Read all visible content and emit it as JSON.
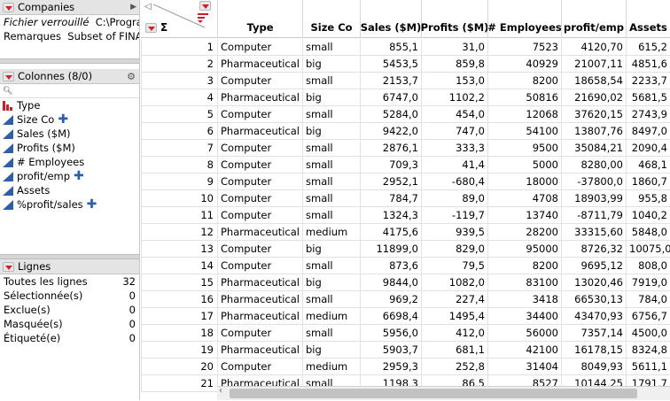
{
  "companies": {
    "title": "Companies",
    "locked_label": "Fichier verrouillé",
    "locked_value": "C:\\Progra",
    "notes_label": "Remarques",
    "notes_value": "Subset of FINA"
  },
  "columns": {
    "title": "Colonnes (8/0)",
    "items": [
      {
        "label": "Type",
        "icon": "nominal-bar-icon",
        "plus": false
      },
      {
        "label": "Size Co",
        "icon": "continuous-triangle-icon",
        "plus": true
      },
      {
        "label": "Sales ($M)",
        "icon": "continuous-triangle-icon",
        "plus": false
      },
      {
        "label": "Profits ($M)",
        "icon": "continuous-triangle-icon",
        "plus": false
      },
      {
        "label": "# Employees",
        "icon": "continuous-triangle-icon",
        "plus": false
      },
      {
        "label": "profit/emp",
        "icon": "continuous-triangle-icon",
        "plus": true
      },
      {
        "label": "Assets",
        "icon": "continuous-triangle-icon",
        "plus": false
      },
      {
        "label": "%profit/sales",
        "icon": "continuous-triangle-icon",
        "plus": true
      }
    ]
  },
  "rows_panel": {
    "title": "Lignes",
    "items": [
      {
        "label": "Toutes les lignes",
        "value": "32"
      },
      {
        "label": "Sélectionnée(s)",
        "value": "0"
      },
      {
        "label": "Exclue(s)",
        "value": "0"
      },
      {
        "label": "Masquée(s)",
        "value": "0"
      },
      {
        "label": "Étiqueté(e)",
        "value": "0"
      }
    ]
  },
  "table": {
    "headers": [
      "Type",
      "Size Co",
      "Sales ($M)",
      "Profits ($M)",
      "# Employees",
      "profit/emp",
      "Assets"
    ],
    "rows": [
      [
        "1",
        "Computer",
        "small",
        "855,1",
        "31,0",
        "7523",
        "4120,70",
        "615,2"
      ],
      [
        "2",
        "Pharmaceutical",
        "big",
        "5453,5",
        "859,8",
        "40929",
        "21007,11",
        "4851,6"
      ],
      [
        "3",
        "Computer",
        "small",
        "2153,7",
        "153,0",
        "8200",
        "18658,54",
        "2233,7"
      ],
      [
        "4",
        "Pharmaceutical",
        "big",
        "6747,0",
        "1102,2",
        "50816",
        "21690,02",
        "5681,5"
      ],
      [
        "5",
        "Computer",
        "small",
        "5284,0",
        "454,0",
        "12068",
        "37620,15",
        "2743,9"
      ],
      [
        "6",
        "Pharmaceutical",
        "big",
        "9422,0",
        "747,0",
        "54100",
        "13807,76",
        "8497,0"
      ],
      [
        "7",
        "Computer",
        "small",
        "2876,1",
        "333,3",
        "9500",
        "35084,21",
        "2090,4"
      ],
      [
        "8",
        "Computer",
        "small",
        "709,3",
        "41,4",
        "5000",
        "8280,00",
        "468,1"
      ],
      [
        "9",
        "Computer",
        "small",
        "2952,1",
        "-680,4",
        "18000",
        "-37800,0",
        "1860,7"
      ],
      [
        "10",
        "Computer",
        "small",
        "784,7",
        "89,0",
        "4708",
        "18903,99",
        "955,8"
      ],
      [
        "11",
        "Computer",
        "small",
        "1324,3",
        "-119,7",
        "13740",
        "-8711,79",
        "1040,2"
      ],
      [
        "12",
        "Pharmaceutical",
        "medium",
        "4175,6",
        "939,5",
        "28200",
        "33315,60",
        "5848,0"
      ],
      [
        "13",
        "Computer",
        "big",
        "11899,0",
        "829,0",
        "95000",
        "8726,32",
        "10075,0"
      ],
      [
        "14",
        "Computer",
        "small",
        "873,6",
        "79,5",
        "8200",
        "9695,12",
        "808,0"
      ],
      [
        "15",
        "Pharmaceutical",
        "big",
        "9844,0",
        "1082,0",
        "83100",
        "13020,46",
        "7919,0"
      ],
      [
        "16",
        "Pharmaceutical",
        "small",
        "969,2",
        "227,4",
        "3418",
        "66530,13",
        "784,0"
      ],
      [
        "17",
        "Pharmaceutical",
        "medium",
        "6698,4",
        "1495,4",
        "34400",
        "43470,93",
        "6756,7"
      ],
      [
        "18",
        "Computer",
        "small",
        "5956,0",
        "412,0",
        "56000",
        "7357,14",
        "4500,0"
      ],
      [
        "19",
        "Pharmaceutical",
        "big",
        "5903,7",
        "681,1",
        "42100",
        "16178,15",
        "8324,8"
      ],
      [
        "20",
        "Computer",
        "medium",
        "2959,3",
        "252,8",
        "31404",
        "8049,93",
        "5611,1"
      ],
      [
        "21",
        "Pharmaceutical",
        "small",
        "1198,3",
        "86,5",
        "8527",
        "10144,25",
        "1791,7"
      ]
    ]
  }
}
